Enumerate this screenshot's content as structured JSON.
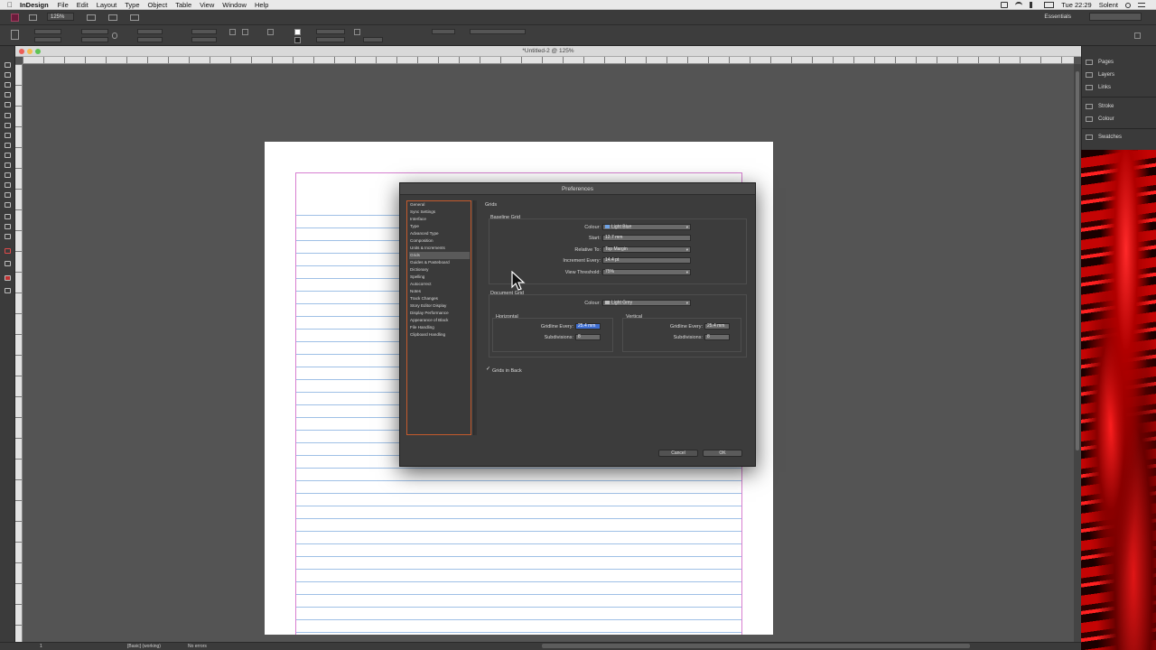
{
  "menubar": {
    "app_name": "InDesign",
    "menus": [
      "File",
      "Edit",
      "Layout",
      "Type",
      "Object",
      "Table",
      "View",
      "Window",
      "Help"
    ],
    "clock": "Tue 22:29",
    "user": "Solent"
  },
  "appbar": {
    "zoom": "125%",
    "workspace": "Essentials"
  },
  "document": {
    "title": "*Untitled-2 @ 125%"
  },
  "right_panels": [
    "Pages",
    "Layers",
    "Links",
    "Stroke",
    "Colour",
    "Swatches"
  ],
  "status": {
    "page": "1",
    "style": "[Basic] (working)",
    "errors": "No errors"
  },
  "prefs": {
    "title": "Preferences",
    "categories": [
      "General",
      "Sync Settings",
      "Interface",
      "Type",
      "Advanced Type",
      "Composition",
      "Units & Increments",
      "Grids",
      "Guides & Pasteboard",
      "Dictionary",
      "Spelling",
      "Autocorrect",
      "Notes",
      "Track Changes",
      "Story Editor Display",
      "Display Performance",
      "Appearance of Black",
      "File Handling",
      "Clipboard Handling"
    ],
    "selected_category": "Grids",
    "panel_title": "Grids",
    "baseline": {
      "heading": "Baseline Grid",
      "colour_label": "Colour:",
      "colour_value": "Light Blue",
      "colour_swatch": "#6fa3e6",
      "start_label": "Start:",
      "start_value": "12.7 mm",
      "relative_label": "Relative To:",
      "relative_value": "Top Margin",
      "increment_label": "Increment Every:",
      "increment_value": "14.4 pt",
      "threshold_label": "View Threshold:",
      "threshold_value": "75%"
    },
    "document_grid": {
      "heading": "Document Grid",
      "colour_label": "Colour:",
      "colour_value": "Light Grey",
      "colour_swatch": "#bdbdbd",
      "horizontal": {
        "heading": "Horizontal",
        "gridline_label": "Gridline Every:",
        "gridline_value": "25.4 mm",
        "subdiv_label": "Subdivisions:",
        "subdiv_value": "8"
      },
      "vertical": {
        "heading": "Vertical",
        "gridline_label": "Gridline Every:",
        "gridline_value": "25.4 mm",
        "subdiv_label": "Subdivisions:",
        "subdiv_value": "8"
      }
    },
    "grids_in_back": {
      "checked": "✓",
      "label": "Grids in Back"
    },
    "cancel_label": "Cancel",
    "ok_label": "OK"
  },
  "colors": {
    "accent_orange": "#c45a2d",
    "selection_blue": "#3f6ed0",
    "margin_magenta": "#d77fd0",
    "baseline_blue": "#9fc0e6"
  }
}
